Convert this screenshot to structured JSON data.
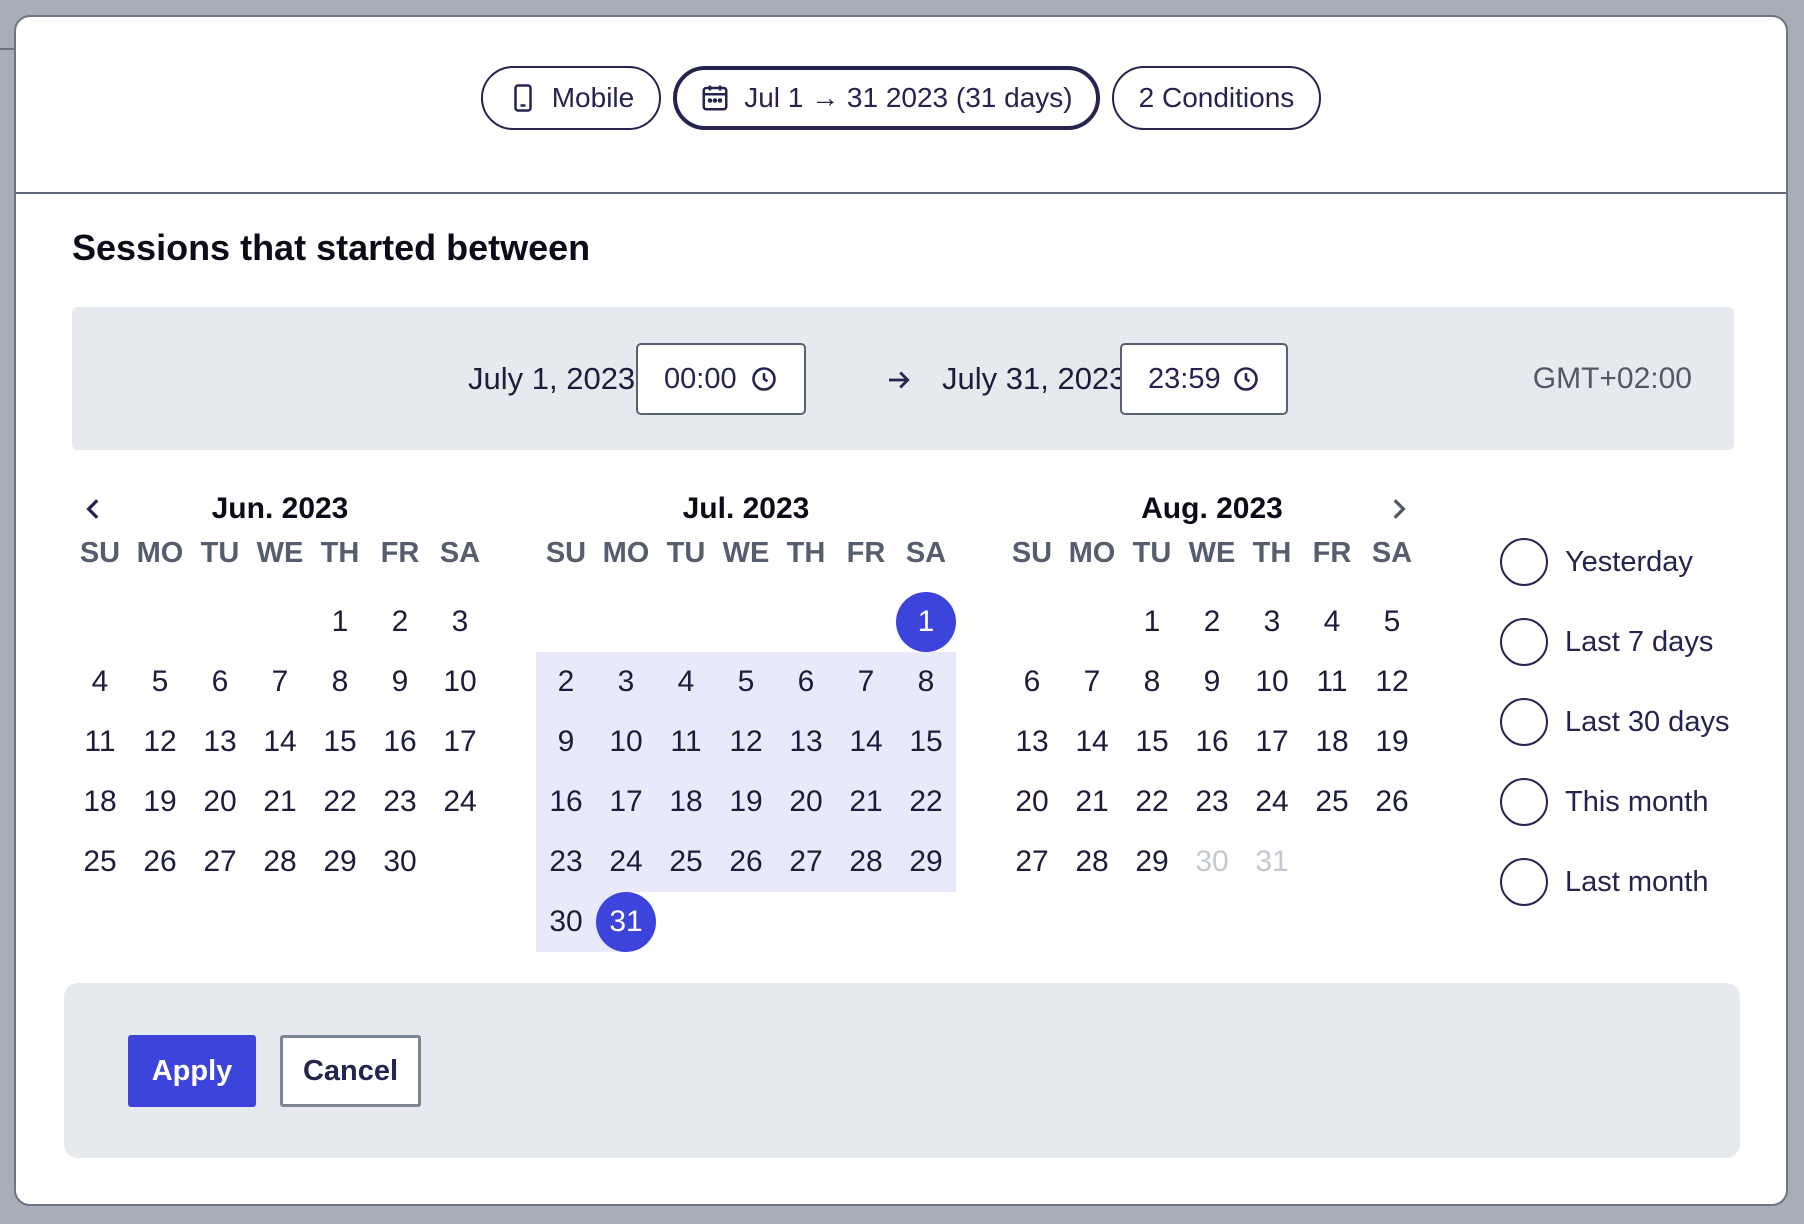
{
  "filters": {
    "device": "Mobile",
    "date_range": "Jul 1 → 31 2023 (31 days)",
    "conditions": "2 Conditions"
  },
  "section_title": "Sessions that started between",
  "time_range": {
    "start_date": "July 1, 2023",
    "start_time": "00:00",
    "end_date": "July 31, 2023",
    "end_time": "23:59",
    "timezone": "GMT+02:00"
  },
  "weekdays": [
    "SU",
    "MO",
    "TU",
    "WE",
    "TH",
    "FR",
    "SA"
  ],
  "months": [
    {
      "title": "Jun. 2023",
      "offset": 4,
      "days": [
        "1",
        "2",
        "3",
        "4",
        "5",
        "6",
        "7",
        "8",
        "9",
        "10",
        "11",
        "12",
        "13",
        "14",
        "15",
        "16",
        "17",
        "18",
        "19",
        "20",
        "21",
        "22",
        "23",
        "24",
        "25",
        "26",
        "27",
        "28",
        "29",
        "30"
      ],
      "range": [],
      "selected": [],
      "muted": []
    },
    {
      "title": "Jul. 2023",
      "offset": 6,
      "days": [
        "1",
        "2",
        "3",
        "4",
        "5",
        "6",
        "7",
        "8",
        "9",
        "10",
        "11",
        "12",
        "13",
        "14",
        "15",
        "16",
        "17",
        "18",
        "19",
        "20",
        "21",
        "22",
        "23",
        "24",
        "25",
        "26",
        "27",
        "28",
        "29",
        "30",
        "31"
      ],
      "range": [
        "2",
        "3",
        "4",
        "5",
        "6",
        "7",
        "8",
        "9",
        "10",
        "11",
        "12",
        "13",
        "14",
        "15",
        "16",
        "17",
        "18",
        "19",
        "20",
        "21",
        "22",
        "23",
        "24",
        "25",
        "26",
        "27",
        "28",
        "29",
        "30"
      ],
      "selected": [
        "1",
        "31"
      ],
      "muted": []
    },
    {
      "title": "Aug. 2023",
      "offset": 2,
      "days": [
        "1",
        "2",
        "3",
        "4",
        "5",
        "6",
        "7",
        "8",
        "9",
        "10",
        "11",
        "12",
        "13",
        "14",
        "15",
        "16",
        "17",
        "18",
        "19",
        "20",
        "21",
        "22",
        "23",
        "24",
        "25",
        "26",
        "27",
        "28",
        "29",
        "30",
        "31"
      ],
      "range": [],
      "selected": [],
      "muted": [
        "30",
        "31"
      ]
    }
  ],
  "presets": [
    "Yesterday",
    "Last 7 days",
    "Last 30 days",
    "This month",
    "Last month"
  ],
  "actions": {
    "apply": "Apply",
    "cancel": "Cancel"
  },
  "colors": {
    "accent": "#3c44db",
    "range": "#e8e9fb",
    "text": "#24244f"
  },
  "icons": {
    "device": "phone-icon",
    "date": "calendar-icon",
    "time": "clock-icon"
  }
}
